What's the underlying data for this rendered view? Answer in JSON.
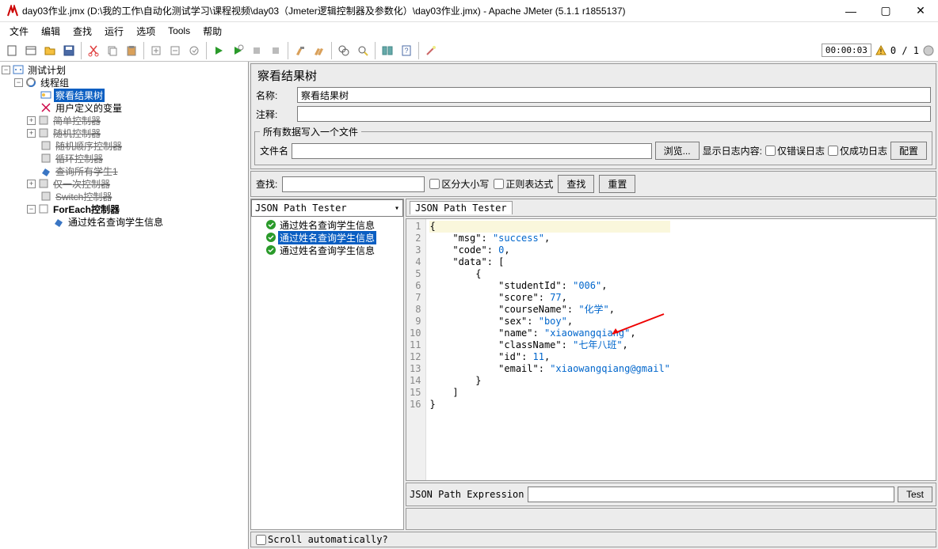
{
  "title": "day03作业.jmx (D:\\我的工作\\自动化测试学习\\课程视频\\day03（Jmeter逻辑控制器及参数化）\\day03作业.jmx) - Apache JMeter (5.1.1 r1855137)",
  "menu": {
    "file": "文件",
    "edit": "编辑",
    "search": "查找",
    "run": "运行",
    "options": "选项",
    "tools": "Tools",
    "help": "帮助"
  },
  "toolbar_right": {
    "timer": "00:00:03",
    "count": "0 / 1"
  },
  "tree": {
    "root": "测试计划",
    "group": "线程组",
    "node_view": "察看结果树",
    "node_vars": "用户定义的变量",
    "node_simple": "简单控制器",
    "node_random": "随机控制器",
    "node_randord": "随机顺序控制器",
    "node_loop": "循环控制器",
    "node_query1": "查询所有学生1",
    "node_once": "仅一次控制器",
    "node_switch": "Switch控制器",
    "node_foreach": "ForEach控制器",
    "node_byname": "通过姓名查询学生信息"
  },
  "panel": {
    "title": "察看结果树",
    "name_label": "名称:",
    "name_value": "察看结果树",
    "comment_label": "注释:",
    "file_section": "所有数据写入一个文件",
    "filename_label": "文件名",
    "browse": "浏览...",
    "log_display": "显示日志内容:",
    "only_error": "仅错误日志",
    "only_success": "仅成功日志",
    "configure": "配置"
  },
  "search": {
    "label": "查找:",
    "case": "区分大小写",
    "regex": "正则表达式",
    "find": "查找",
    "reset": "重置"
  },
  "dropdown": "JSON Path Tester",
  "result_items": [
    "通过姓名查询学生信息",
    "通过姓名查询学生信息",
    "通过姓名查询学生信息"
  ],
  "result_selected": 1,
  "tab_title": "JSON Path Tester",
  "code_lines": [
    "{",
    "    \"msg\": \"success\",",
    "    \"code\": 0,",
    "    \"data\": [",
    "        {",
    "            \"studentId\": \"006\",",
    "            \"score\": 77,",
    "            \"courseName\": \"化学\",",
    "            \"sex\": \"boy\",",
    "            \"name\": \"xiaowangqiang\",",
    "            \"className\": \"七年八班\",",
    "            \"id\": 11,",
    "            \"email\": \"xiaowangqiang@gmail\"",
    "        }",
    "    ]",
    "}"
  ],
  "expr": {
    "label": "JSON Path Expression",
    "test": "Test"
  },
  "bottom": {
    "scroll": "Scroll automatically?"
  }
}
